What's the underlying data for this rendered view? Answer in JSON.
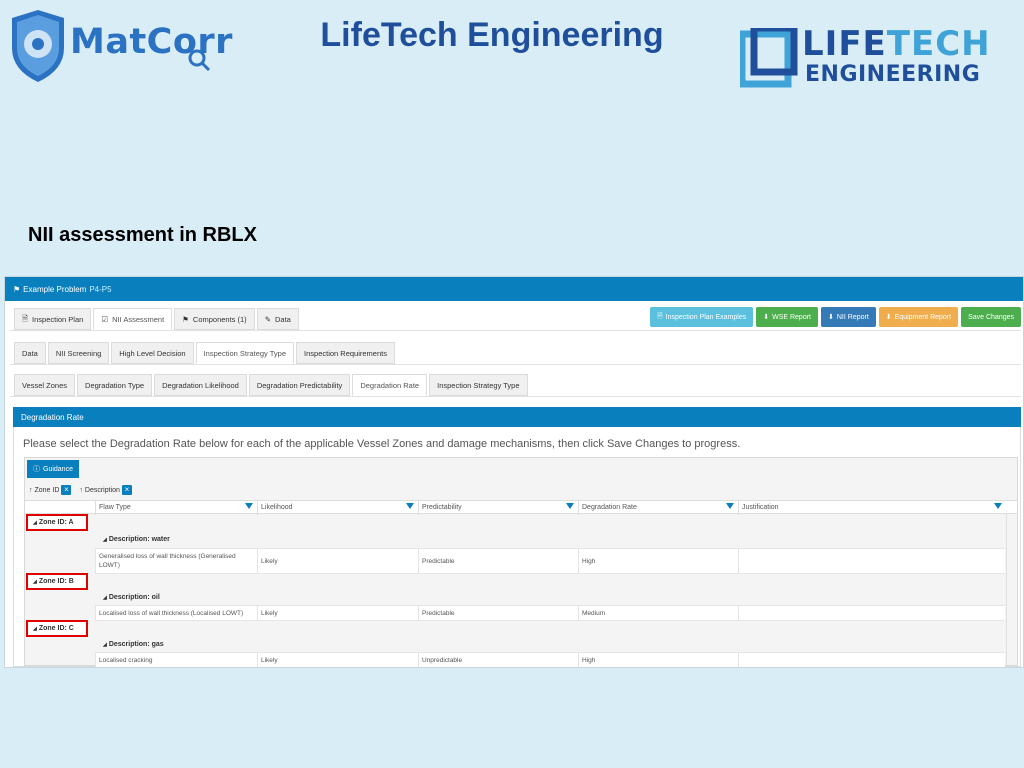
{
  "slide": {
    "title": "LifeTech Engineering",
    "subtitle": "NII assessment in RBLX",
    "logos": {
      "matcorr": "MatCorr",
      "lifetech_line1_a": "LIFE",
      "lifetech_line1_b": "TECH",
      "lifetech_line2": "ENGINEERING"
    }
  },
  "app": {
    "problem_prefix": "Example Problem",
    "problem_code": "P4-P5",
    "main_tabs": [
      {
        "label": "Inspection Plan",
        "icon": "document-icon"
      },
      {
        "label": "NII Assessment",
        "icon": "checkbox-icon",
        "active": true
      },
      {
        "label": "Components (1)",
        "icon": "tag-icon"
      },
      {
        "label": "Data",
        "icon": "edit-icon"
      }
    ],
    "action_buttons": [
      {
        "label": "Inspection Plan Examples",
        "color": "#5bc0de"
      },
      {
        "label": "WSE Report",
        "color": "#4cae4c"
      },
      {
        "label": "NII Report",
        "color": "#337ab7"
      },
      {
        "label": "Equipment Report",
        "color": "#f0ad4e"
      },
      {
        "label": "Save Changes",
        "color": "#4cae4c"
      }
    ],
    "sub_tabs": [
      "Data",
      "NII Screening",
      "High Level Decision",
      "Inspection Strategy Type",
      "Inspection Requirements"
    ],
    "sub_tab_active": 3,
    "third_tabs": [
      "Vessel Zones",
      "Degradation Type",
      "Degradation Likelihood",
      "Degradation Predictability",
      "Degradation Rate",
      "Inspection Strategy Type"
    ],
    "third_tab_active": 4,
    "section_title": "Degradation Rate",
    "instruction": "Please select the Degradation Rate below for each of the applicable Vessel Zones and damage mechanisms, then click Save Changes to progress.",
    "guidance_label": "Guidance",
    "group_chips": [
      "Zone ID",
      "Description"
    ],
    "columns": [
      "Flaw Type",
      "Likelihood",
      "Predictability",
      "Degradation Rate",
      "Justification"
    ],
    "groups": [
      {
        "zone": "Zone ID: A",
        "description": "Description: water",
        "rows": [
          {
            "flaw": "Generalised loss of wall thickness (Generalised LOWT)",
            "likelihood": "Likely",
            "predictability": "Predictable",
            "rate": "High",
            "justification": ""
          }
        ]
      },
      {
        "zone": "Zone ID: B",
        "description": "Description: oil",
        "rows": [
          {
            "flaw": "Localised loss of wall thickness (Localised LOWT)",
            "likelihood": "Likely",
            "predictability": "Predictable",
            "rate": "Medium",
            "justification": ""
          }
        ]
      },
      {
        "zone": "Zone ID: C",
        "description": "Description: gas",
        "rows": [
          {
            "flaw": "Localised cracking",
            "likelihood": "Likely",
            "predictability": "Unpredictable",
            "rate": "High",
            "justification": ""
          }
        ]
      }
    ],
    "highlight_color": "#e00000",
    "accent_color": "#0a7fbd"
  }
}
